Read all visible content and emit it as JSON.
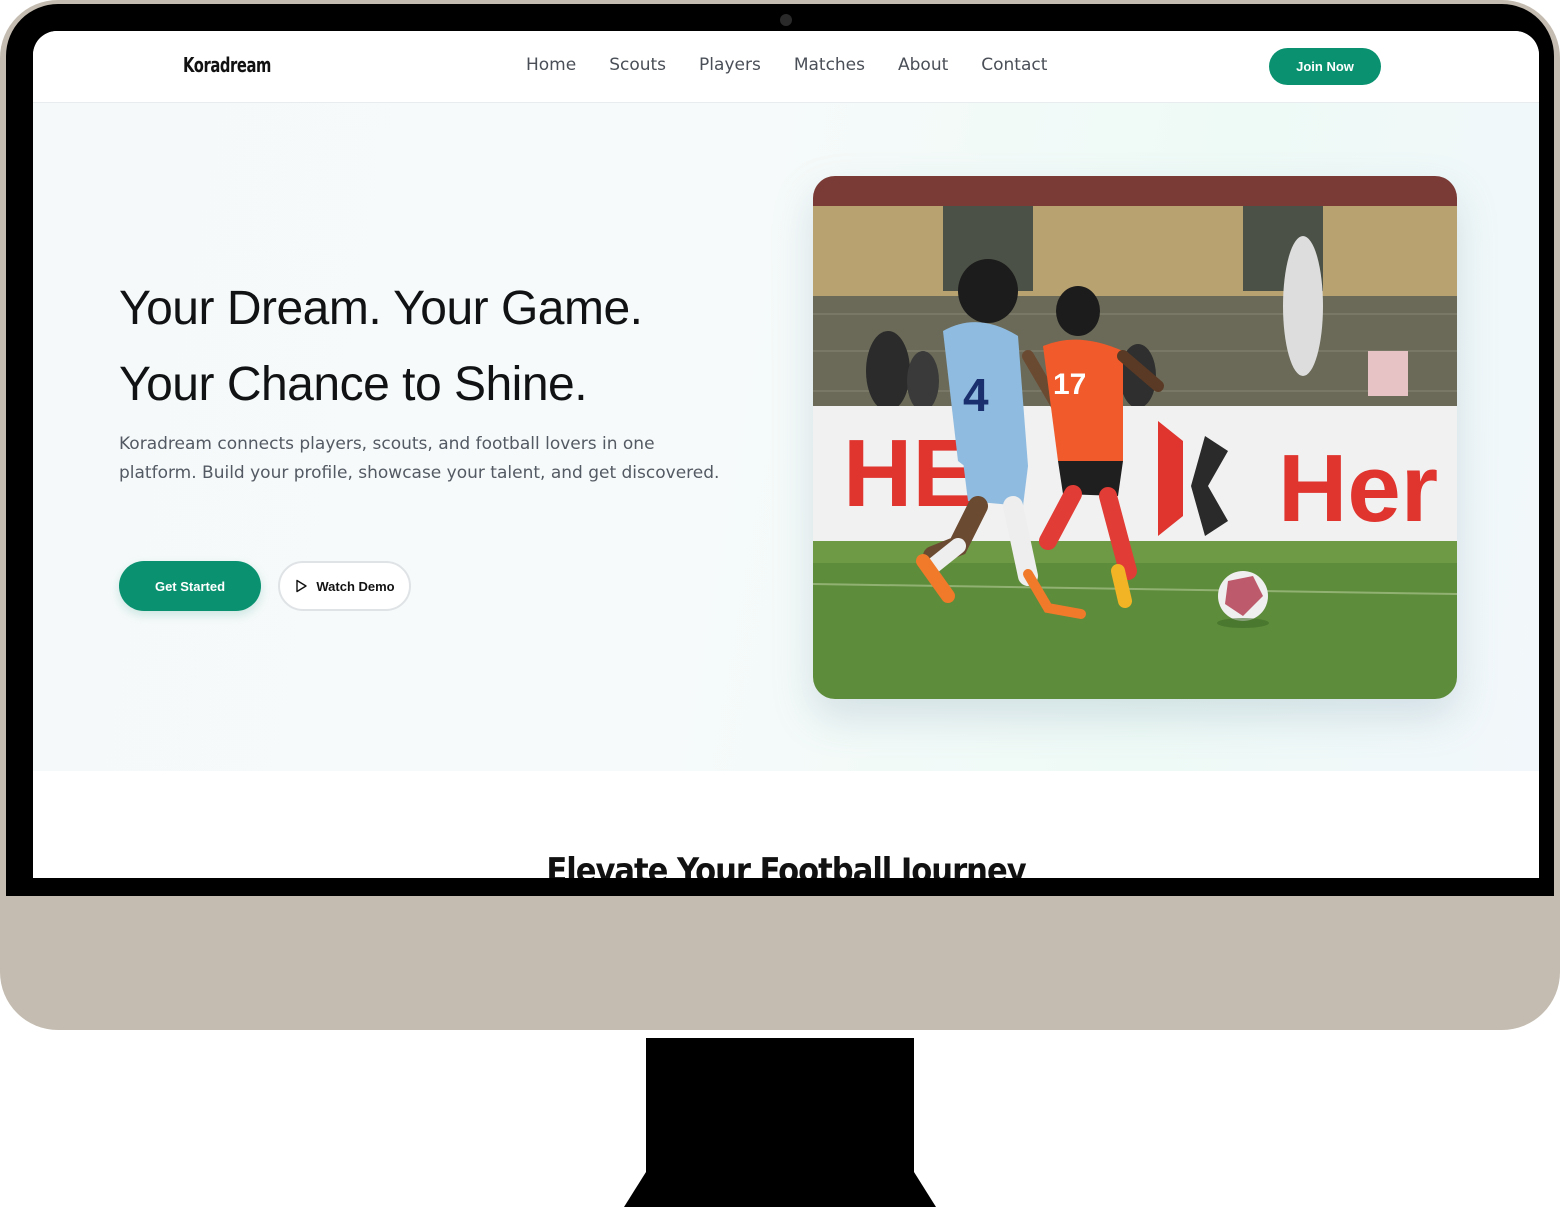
{
  "brand": {
    "name": "Koradream"
  },
  "nav": {
    "links": [
      "Home",
      "Scouts",
      "Players",
      "Matches",
      "About",
      "Contact"
    ],
    "cta": "Join Now"
  },
  "hero": {
    "title_line1": "Your Dream. Your Game.",
    "title_line2": "Your Chance to Shine.",
    "description": "Koradream connects players, scouts, and football lovers in one platform. Build your profile, showcase your talent, and get discovered.",
    "primary_button": "Get Started",
    "secondary_button": "Watch Demo",
    "photo": {
      "board_text_left": "HE",
      "board_text_right": "Her",
      "player_left_number": "4",
      "player_right_number": "17"
    }
  },
  "section": {
    "title": "Elevate Your Football Journey"
  },
  "colors": {
    "accent": "#0a9270",
    "monitor_body": "#c4bcb0"
  },
  "icons": {
    "play": "play-icon"
  }
}
